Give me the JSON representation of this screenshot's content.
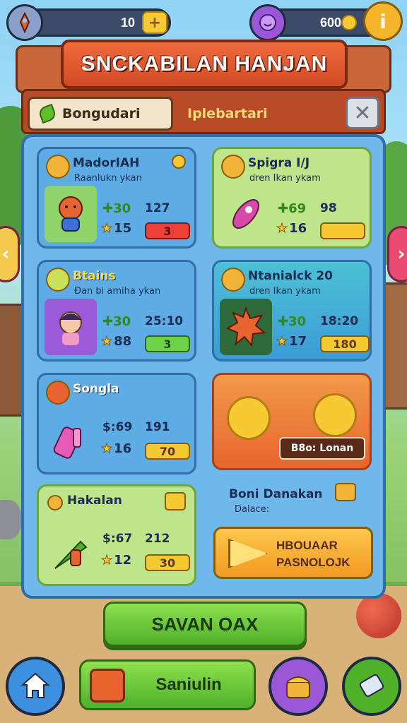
{
  "top_bar": {
    "left_resource_value": "10",
    "right_resource_value": "600",
    "plus_label": "+",
    "info_label": "i"
  },
  "title": "SNCKABILAN HANJAN",
  "tabs": [
    {
      "label": "Bongudari",
      "active": true
    },
    {
      "label": "Iplebartari",
      "active": false
    }
  ],
  "close_label": "✕",
  "cards": [
    {
      "name": "MadorIAH",
      "sub": "Raanlukn ykan",
      "stat_a": "30",
      "stat_b": "127",
      "stars": "15",
      "pill": "3"
    },
    {
      "name": "Spigra I/J",
      "sub": "dren Ikan ykam",
      "stat_a": "69",
      "stat_b": "98",
      "stars": "16",
      "pill": ""
    },
    {
      "name": "Btains",
      "sub": "Ɖan bi amiha ykan",
      "stat_a": "30",
      "stat_b": "25:10",
      "stars": "88",
      "pill": "3"
    },
    {
      "name": "Ntanialck 20",
      "sub": "dren Ikan ykam",
      "stat_a": "30",
      "stat_b": "18:20",
      "stars": "17",
      "pill": "180"
    },
    {
      "name": "Songla",
      "sub": "",
      "stat_a": "69",
      "stat_b": "191",
      "stars": "16",
      "pill": "70"
    },
    {
      "name": "Hakalan",
      "sub": "",
      "stat_a": "67",
      "stat_b": "212",
      "stars": "12",
      "pill": "30"
    }
  ],
  "promo": {
    "label": "B8o: Lonan"
  },
  "free_offer": {
    "title": "Boni Danakan",
    "sub": "Dalace:",
    "button_line1": "HBOUAAR",
    "button_line2": "PASNOLOJK"
  },
  "save_button": "SAVAN OAX",
  "start_button": "Saniulin",
  "colors": {
    "panel": "#6fb8ec",
    "banner": "#d24a22",
    "primary_button": "#4fb02a",
    "coin": "#f7c933"
  }
}
